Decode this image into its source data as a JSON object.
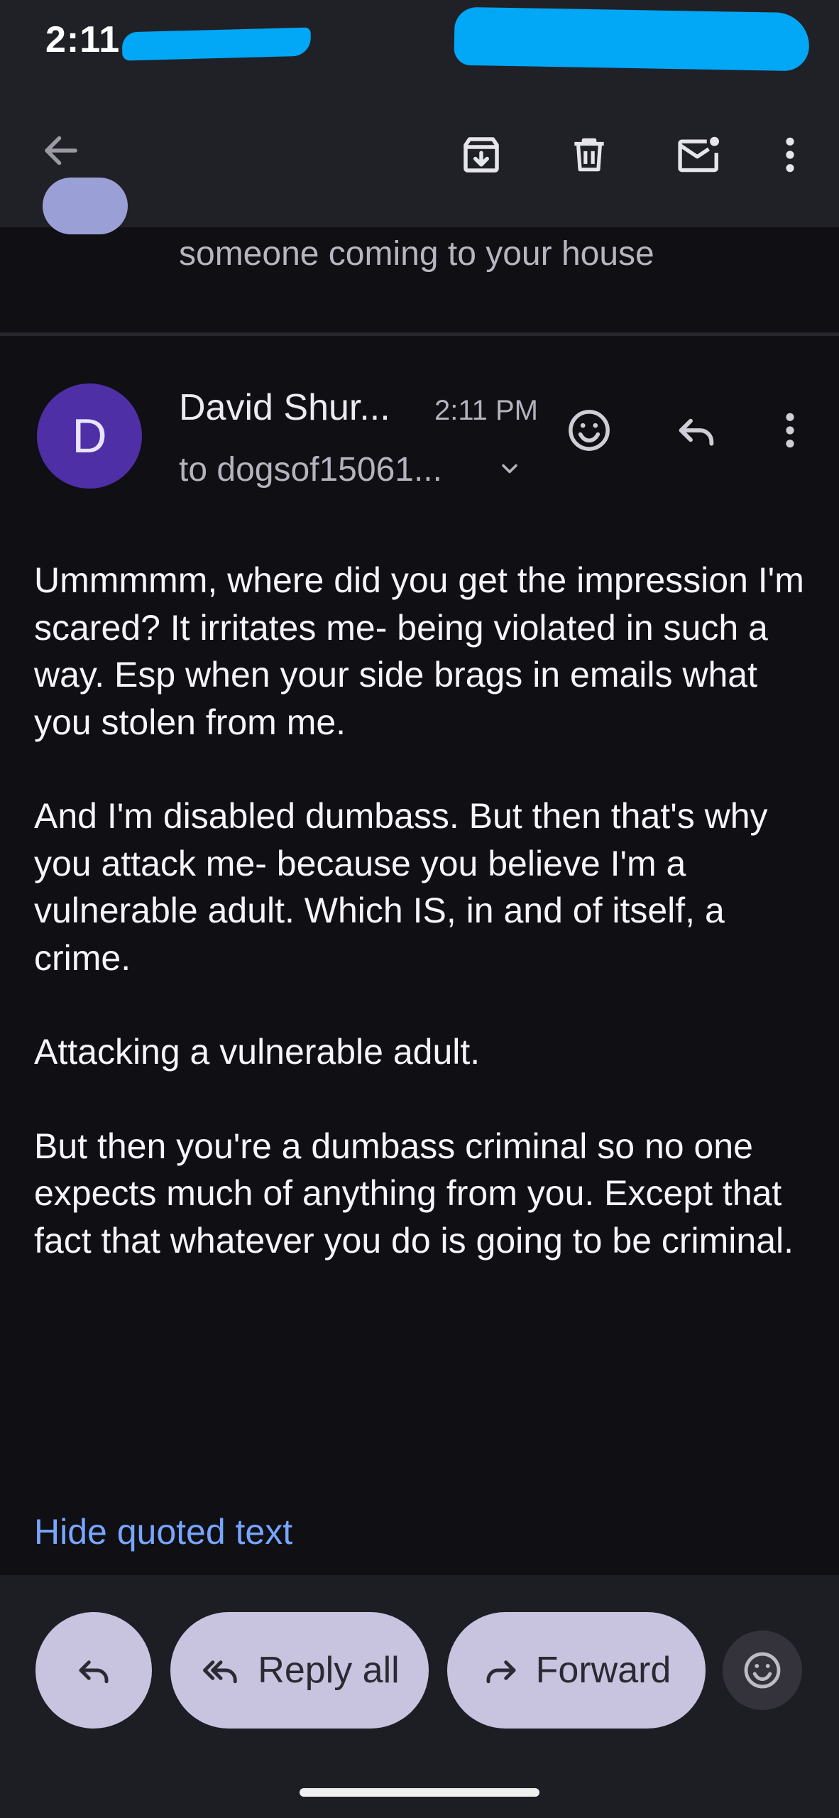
{
  "status_bar": {
    "time": "2:11"
  },
  "app_bar": {
    "icons": [
      "back-arrow-icon",
      "archive-icon",
      "delete-icon",
      "mark-unread-icon",
      "more-vert-icon"
    ]
  },
  "previous_message": {
    "snippet": "someone coming to your house"
  },
  "message": {
    "avatar_letter": "D",
    "sender": "David Shur...",
    "time": "2:11 PM",
    "recipient": "to dogsof15061...",
    "body": [
      "Ummmmm, where did you get the impression I'm scared? It irritates me- being violated in such a way. Esp when your side brags in emails what you stolen from me.",
      "And I'm disabled dumbass. But then that's why you attack me- because you believe I'm a vulnerable adult. Which IS, in and of itself, a crime.",
      "Attacking a vulnerable adult.",
      "But then you're a dumbass criminal so no one expects much of anything from you. Except that fact that whatever you do is going to be criminal."
    ],
    "hide_quoted": "Hide quoted text"
  },
  "actions": {
    "reply_all": "Reply all",
    "forward": "Forward"
  },
  "colors": {
    "background": "#0f0f14",
    "bar": "#202027",
    "avatar": "#4f2fa6",
    "link": "#78a6ff",
    "pill": "#c8c4e0",
    "redaction": "#02a7f5"
  }
}
